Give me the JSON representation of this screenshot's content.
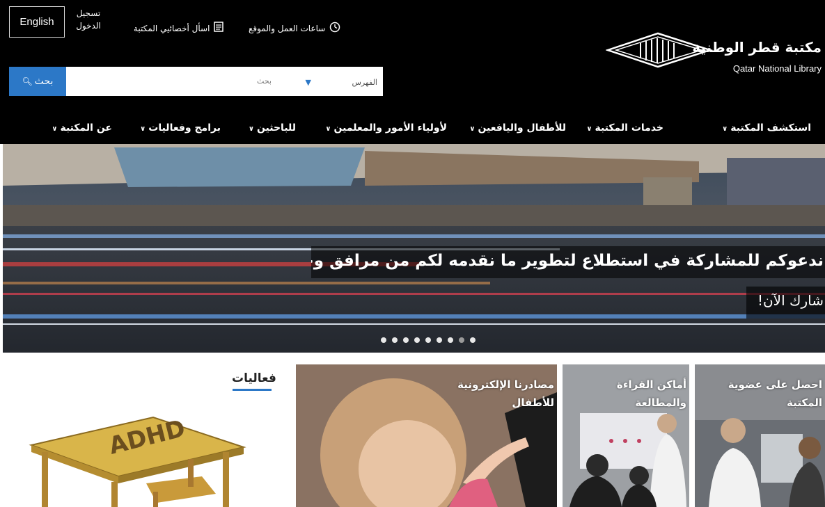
{
  "header": {
    "language_button": "English",
    "login": "تسجيل الدخول",
    "ask_librarian": "اسأل أخصائيي المكتبة",
    "hours_location": "ساعات العمل والموقع"
  },
  "logo": {
    "name_ar": "مكتبة قطر الوطنية",
    "name_en": "Qatar National Library"
  },
  "search": {
    "button_label": "بحث",
    "scope_selected": "الفهرس",
    "placeholder": "بحث"
  },
  "nav": {
    "items": [
      {
        "label": "استكشف المكتبة"
      },
      {
        "label": "خدمات المكتبة"
      },
      {
        "label": "للأطفال واليافعين"
      },
      {
        "label": "لأولياء الأمور والمعلمين"
      },
      {
        "label": "للباحثين"
      },
      {
        "label": "برامج وفعاليات"
      },
      {
        "label": "عن المكتبة"
      }
    ]
  },
  "hero": {
    "headline": "ندعوكم للمشاركة في استطلاع لتطوير ما نقدمه لكم من مرافق وخدمات.",
    "cta": "شارك الآن!",
    "slide_count": 9,
    "active_slide": 8
  },
  "events": {
    "title": "فعاليات",
    "image_text": "ADHD"
  },
  "tiles": [
    {
      "label": "احصل على عضوية المكتبة"
    },
    {
      "label": "أماكن القراءة والمطالعة"
    },
    {
      "label": "مصادرنا الإلكترونية للأطفال"
    }
  ],
  "colors": {
    "header_bg": "#000000",
    "accent_blue": "#2c78c7"
  }
}
